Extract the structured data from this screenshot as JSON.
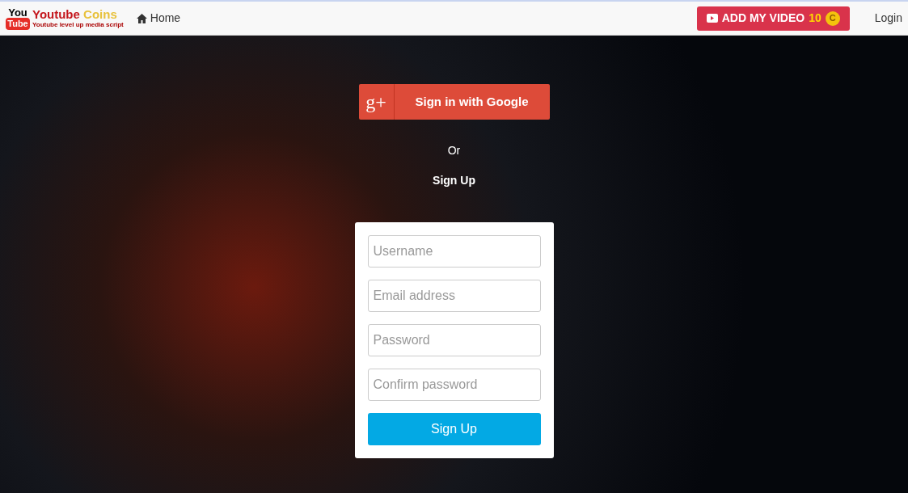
{
  "navbar": {
    "logo": {
      "icon_top": "You",
      "icon_bottom": "Tube",
      "title_main": "Youtube",
      "title_accent": "Coins",
      "tagline": "Youtube level up media script"
    },
    "home_link": "Home",
    "add_video": {
      "label": "ADD MY VIDEO",
      "coins": "10",
      "coin_symbol": "C"
    },
    "login_link": "Login"
  },
  "auth": {
    "google": {
      "glyph": "g+",
      "label": "Sign in with Google"
    },
    "or": "Or",
    "signup_heading": "Sign Up",
    "fields": [
      {
        "placeholder": "Username"
      },
      {
        "placeholder": "Email address"
      },
      {
        "placeholder": "Password"
      },
      {
        "placeholder": "Confirm password"
      }
    ],
    "submit": "Sign Up"
  }
}
